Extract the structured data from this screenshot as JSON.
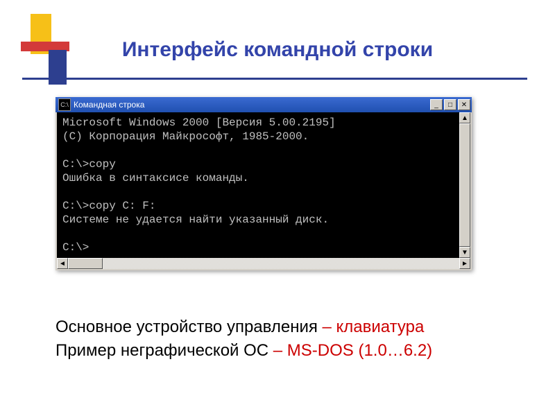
{
  "slide": {
    "title": "Интерфейс командной строки",
    "caption": {
      "line1_a": "Основное устройство управления ",
      "line1_b": "– клавиатура",
      "line2_a": "Пример неграфической ОС ",
      "line2_b": "– MS-DOS (1.0…6.2)"
    }
  },
  "window": {
    "icon_label": "C:\\",
    "title": "Командная строка",
    "buttons": {
      "min": "_",
      "max": "□",
      "close": "✕"
    },
    "terminal": "Microsoft Windows 2000 [Версия 5.00.2195]\n(C) Корпорация Майкрософт, 1985-2000.\n\nC:\\>copy\nОшибка в синтаксисе команды.\n\nC:\\>copy C: F:\nСистеме не удается найти указанный диск.\n\nC:\\>",
    "scroll": {
      "left": "◄",
      "right": "►",
      "up": "▲",
      "down": "▼"
    }
  }
}
